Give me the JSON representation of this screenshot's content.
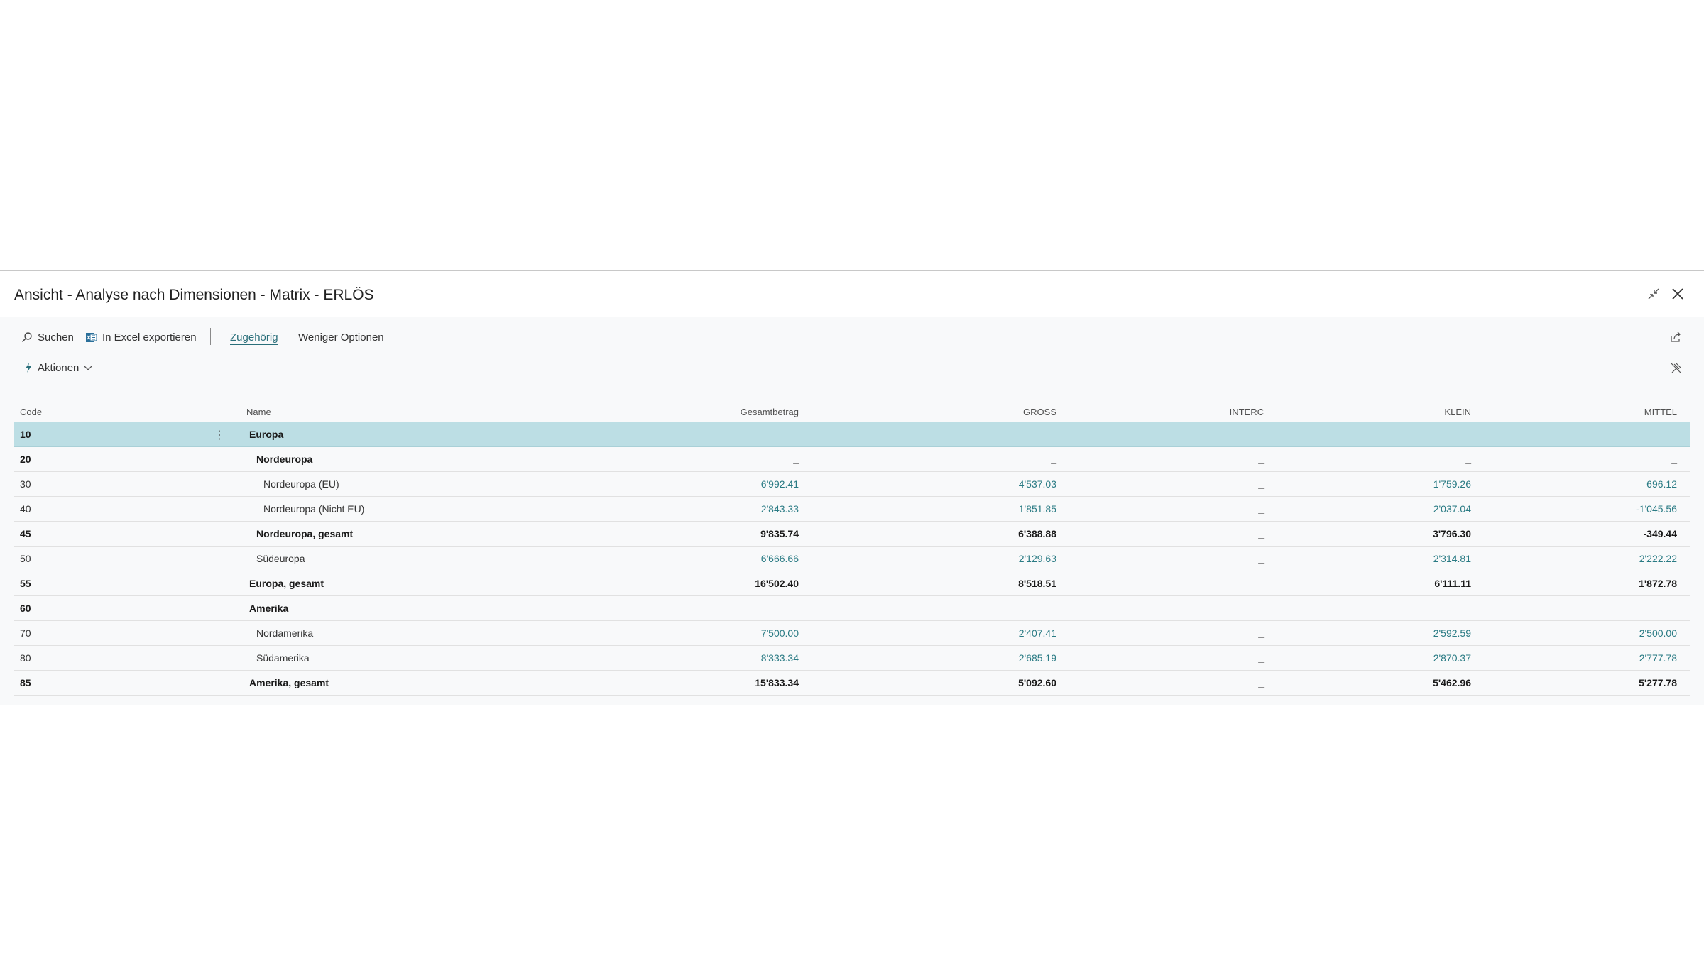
{
  "dialog": {
    "title": "Ansicht - Analyse nach Dimensionen - Matrix - ERLÖS"
  },
  "toolbar": {
    "search_label": "Suchen",
    "excel_label": "In Excel exportieren",
    "related_label": "Zugehörig",
    "fewer_options_label": "Weniger Optionen",
    "actions_label": "Aktionen"
  },
  "table": {
    "headers": {
      "code": "Code",
      "name": "Name",
      "total": "Gesamtbetrag",
      "gross": "GROSS",
      "interc": "INTERC",
      "klein": "KLEIN",
      "mittel": "MITTEL"
    },
    "rows": [
      {
        "code": "10",
        "name": "Europa",
        "total": "_",
        "gross": "_",
        "interc": "_",
        "klein": "_",
        "mittel": "_"
      },
      {
        "code": "20",
        "name": "Nordeuropa",
        "total": "_",
        "gross": "_",
        "interc": "_",
        "klein": "_",
        "mittel": "_"
      },
      {
        "code": "30",
        "name": "Nordeuropa (EU)",
        "total": "6'992.41",
        "gross": "4'537.03",
        "interc": "_",
        "klein": "1'759.26",
        "mittel": "696.12"
      },
      {
        "code": "40",
        "name": "Nordeuropa (Nicht EU)",
        "total": "2'843.33",
        "gross": "1'851.85",
        "interc": "_",
        "klein": "2'037.04",
        "mittel": "-1'045.56"
      },
      {
        "code": "45",
        "name": "Nordeuropa, gesamt",
        "total": "9'835.74",
        "gross": "6'388.88",
        "interc": "_",
        "klein": "3'796.30",
        "mittel": "-349.44"
      },
      {
        "code": "50",
        "name": "Südeuropa",
        "total": "6'666.66",
        "gross": "2'129.63",
        "interc": "_",
        "klein": "2'314.81",
        "mittel": "2'222.22"
      },
      {
        "code": "55",
        "name": "Europa, gesamt",
        "total": "16'502.40",
        "gross": "8'518.51",
        "interc": "_",
        "klein": "6'111.11",
        "mittel": "1'872.78"
      },
      {
        "code": "60",
        "name": "Amerika",
        "total": "_",
        "gross": "_",
        "interc": "_",
        "klein": "_",
        "mittel": "_"
      },
      {
        "code": "70",
        "name": "Nordamerika",
        "total": "7'500.00",
        "gross": "2'407.41",
        "interc": "_",
        "klein": "2'592.59",
        "mittel": "2'500.00"
      },
      {
        "code": "80",
        "name": "Südamerika",
        "total": "8'333.34",
        "gross": "2'685.19",
        "interc": "_",
        "klein": "2'870.37",
        "mittel": "2'777.78"
      },
      {
        "code": "85",
        "name": "Amerika, gesamt",
        "total": "15'833.34",
        "gross": "5'092.60",
        "interc": "_",
        "klein": "5'462.96",
        "mittel": "5'277.78"
      }
    ]
  },
  "colors": {
    "selected_row": "#bcdee4",
    "link": "#2a7b84"
  }
}
